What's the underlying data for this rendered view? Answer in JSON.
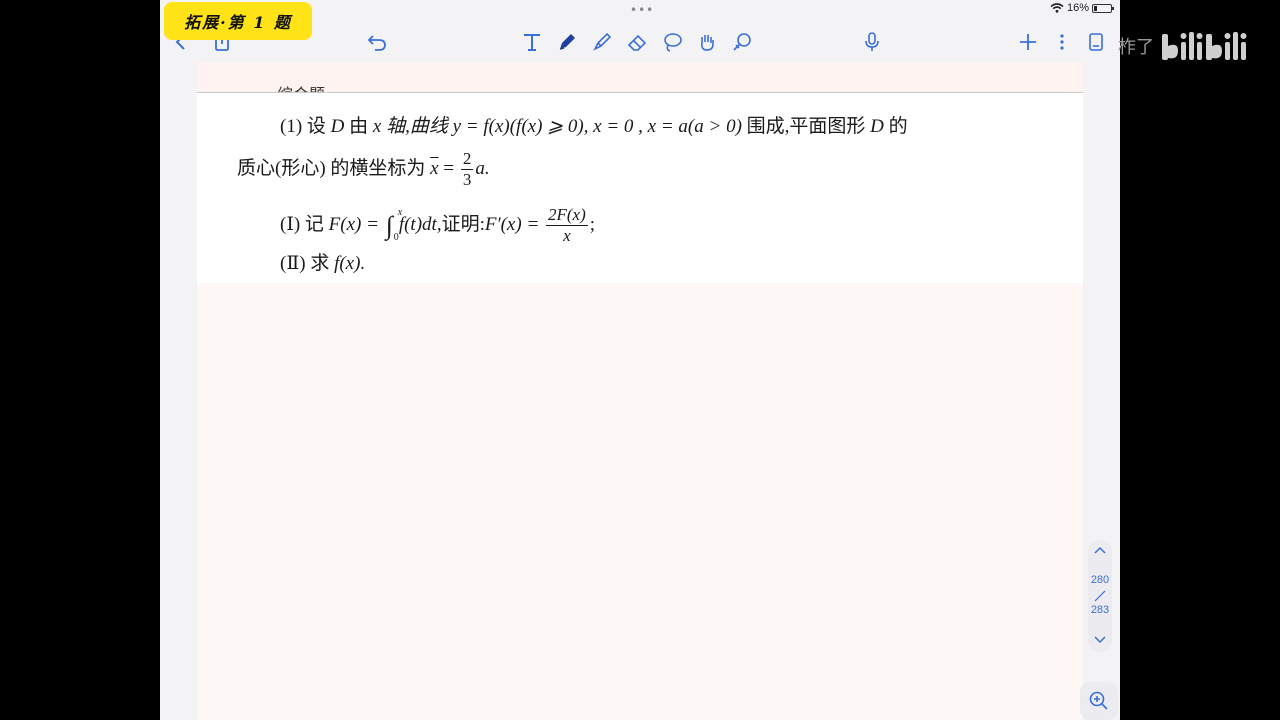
{
  "status_bar": {
    "dots": "•••",
    "battery_percent": "16%"
  },
  "toolbar": {
    "page_tag": "拓展·第 1 题",
    "icons": [
      "back-icon",
      "export-icon",
      "undo-icon",
      "text-tool-icon",
      "pen-icon",
      "highlighter-icon",
      "eraser-icon",
      "lasso-icon",
      "hand-icon",
      "shape-icon",
      "mic-icon",
      "add-icon",
      "more-icon",
      "pages-icon"
    ]
  },
  "document": {
    "cutoff_heading": "综合题",
    "problem_number": "(1)",
    "line1_intro": "设",
    "D": "D",
    "line1_mid": "由",
    "x_axis": "x 轴,曲线",
    "curve": "y = f(x)(f(x) ⩾ 0)",
    "bounds": ", x = 0 , x = a(a > 0)",
    "line1_end": "围成,平面图形",
    "line1_D2": "D",
    "line1_de": "的",
    "line2_text": "质心(形心) 的横坐标为",
    "xbar": "x",
    "equals": " = ",
    "frac_num": "2",
    "frac_den": "3",
    "line2_end": "a.",
    "part1_label": "(Ⅰ) 记",
    "part1_F": "F(x) = ",
    "int_upper": "x",
    "int_lower": "0",
    "part1_integrand": "f(t)dt",
    "part1_mid": ",证明:",
    "part1_Fprime": "F′(x) = ",
    "part1_frac_num": "2F(x)",
    "part1_frac_den": "x",
    "part1_end": ";",
    "part2_label": "(Ⅱ) 求",
    "part2_f": "f(x).",
    "accent_color": "#3a6fd8",
    "tag_color": "#ffe317"
  },
  "page_nav": {
    "current": "280",
    "total": "283"
  },
  "watermark": {
    "text": "柞了",
    "logo": "bilibili-logo"
  }
}
